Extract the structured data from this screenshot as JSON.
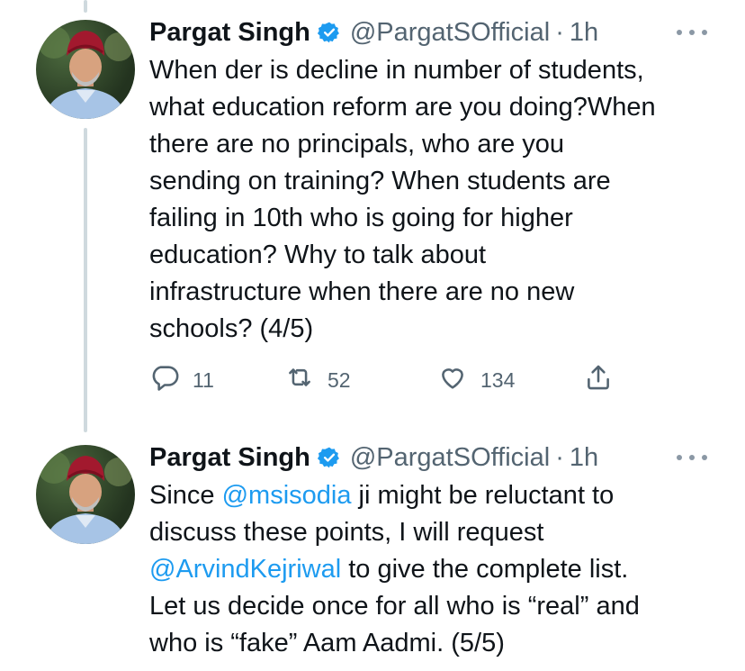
{
  "tweets": [
    {
      "author_name": "Pargat Singh",
      "handle": "@PargatSOfficial",
      "separator": "·",
      "time": "1h",
      "text_lines": [
        "When der is decline in number of students,",
        "what education reform are you doing?When",
        "there are no principals, who are you",
        "sending on training? When students are",
        "failing in 10th who is going for higher",
        "education? Why to talk about",
        "infrastructure when there are no new",
        "schools? (4/5)"
      ],
      "counts": {
        "replies": "11",
        "retweets": "52",
        "likes": "134"
      }
    },
    {
      "author_name": "Pargat Singh",
      "handle": "@PargatSOfficial",
      "separator": "·",
      "time": "1h",
      "text": {
        "l1_pre": "Since ",
        "l1_mention": "@msisodia",
        "l1_post": " ji might be reluctant to",
        "l2": "discuss these points, I will request",
        "l3_mention": "@ArvindKejriwal",
        "l3_post": " to give the complete list.",
        "l4": "Let us decide once for all who is “real” and",
        "l5": "who is “fake” Aam Aadmi. (5/5)"
      }
    }
  ],
  "icons": {
    "verified": "verified-badge-icon",
    "more": "more-options-icon",
    "reply": "reply-icon",
    "retweet": "retweet-icon",
    "like": "heart-icon",
    "share": "share-icon"
  },
  "colors": {
    "text": "#0f1419",
    "secondary": "#536471",
    "link": "#1d9bf0",
    "verified": "#1d9bf0",
    "thread_line": "#cfd9de"
  }
}
